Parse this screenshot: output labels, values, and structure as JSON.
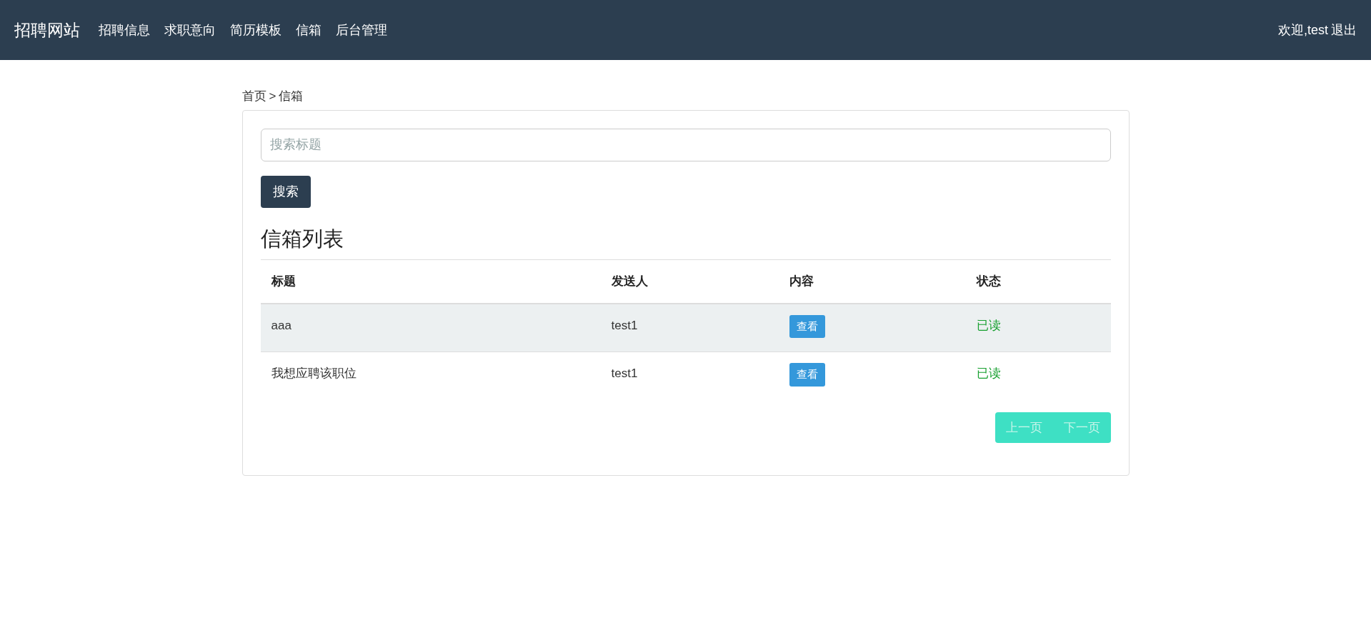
{
  "navbar": {
    "brand": "招聘网站",
    "links": [
      "招聘信息",
      "求职意向",
      "简历模板",
      "信箱",
      "后台管理"
    ],
    "welcome": "欢迎,test",
    "logout": "退出"
  },
  "breadcrumb": {
    "home": "首页",
    "separator": ">",
    "current": "信箱"
  },
  "search": {
    "placeholder": "搜索标题",
    "button": "搜索"
  },
  "heading": "信箱列表",
  "table": {
    "columns": [
      "标题",
      "发送人",
      "内容",
      "状态"
    ],
    "rows": [
      {
        "title": "aaa",
        "sender": "test1",
        "action": "查看",
        "status": "已读",
        "read": true,
        "highlighted": true
      },
      {
        "title": "我想应聘该职位",
        "sender": "test1",
        "action": "查看",
        "status": "已读",
        "read": true,
        "highlighted": false
      }
    ]
  },
  "pager": {
    "disabled": true,
    "buttons": [
      "上一页",
      "下一页"
    ]
  }
}
